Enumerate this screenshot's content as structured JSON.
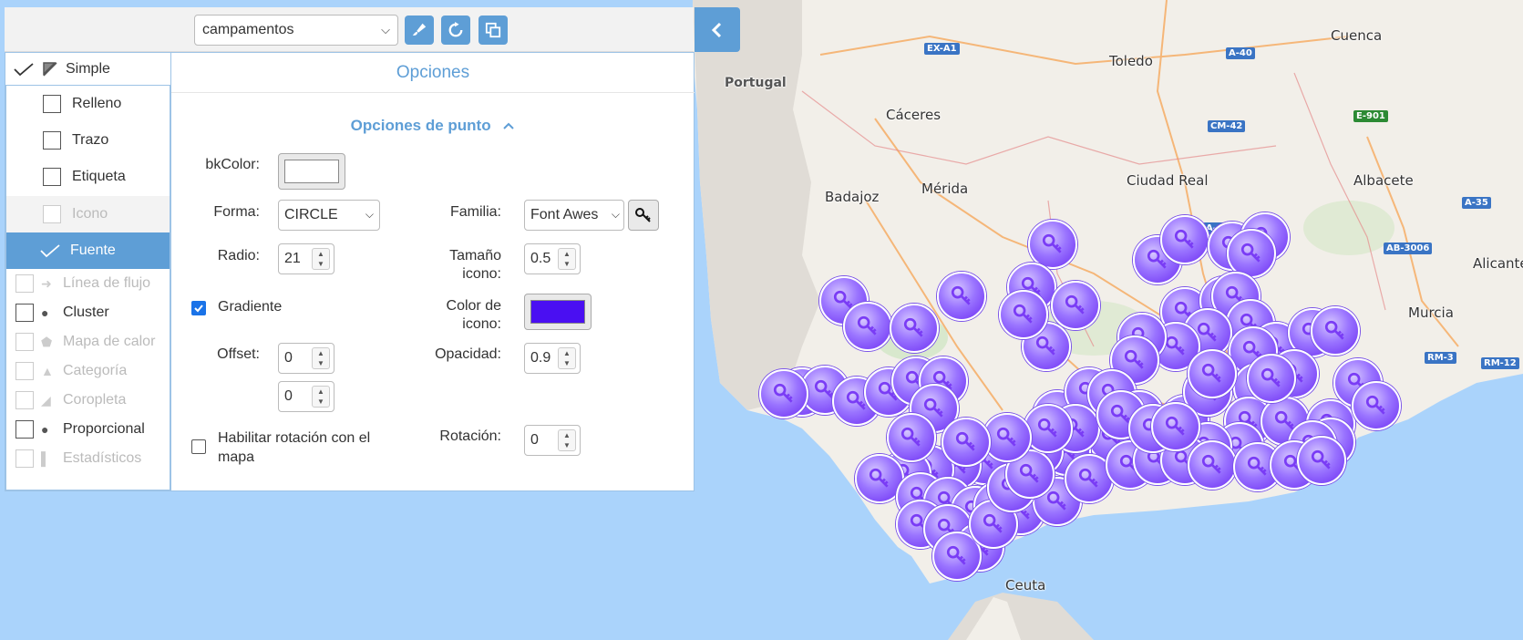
{
  "toolbar": {
    "layer_select_value": "campamentos",
    "buttons": [
      "brush-icon",
      "refresh-icon",
      "copy-icon"
    ],
    "collapse_icon": "chevron-left-icon"
  },
  "style_types": {
    "simple": {
      "label": "Simple",
      "checked": true
    },
    "sub_items": [
      {
        "label": "Relleno",
        "checked": false,
        "disabled": false
      },
      {
        "label": "Trazo",
        "checked": false,
        "disabled": false
      },
      {
        "label": "Etiqueta",
        "checked": false,
        "disabled": false
      },
      {
        "label": "Icono",
        "checked": false,
        "disabled": true
      },
      {
        "label": "Fuente",
        "checked": true,
        "selected": true
      }
    ],
    "other_items": [
      {
        "label": "Línea de flujo",
        "icon": "arrow-right-icon",
        "disabled": true
      },
      {
        "label": "Cluster",
        "icon": "cluster-icon",
        "disabled": false
      },
      {
        "label": "Mapa de calor",
        "icon": "heatmap-icon",
        "disabled": true
      },
      {
        "label": "Categoría",
        "icon": "category-icon",
        "disabled": true
      },
      {
        "label": "Coropleta",
        "icon": "choropleth-icon",
        "disabled": true
      },
      {
        "label": "Proporcional",
        "icon": "proportional-icon",
        "disabled": false
      },
      {
        "label": "Estadísticos",
        "icon": "bar-chart-icon",
        "disabled": true
      }
    ]
  },
  "options": {
    "title": "Opciones",
    "point_section": "Opciones de punto",
    "bkcolor_label": "bkColor:",
    "bkcolor_value": "#ffffff",
    "forma_label": "Forma:",
    "forma_value": "CIRCLE",
    "familia_label": "Familia:",
    "familia_value": "Font Awes",
    "radio_label": "Radio:",
    "radio_value": "21",
    "tamano_label_1": "Tamaño",
    "tamano_label_2": "icono:",
    "tamano_value": "0.5",
    "gradiente_label": "Gradiente",
    "gradiente_checked": true,
    "color_icono_label_1": "Color de",
    "color_icono_label_2": "icono:",
    "color_icono_value": "#4a0ff2",
    "offset_label": "Offset:",
    "offset_x": "0",
    "offset_y": "0",
    "opacidad_label": "Opacidad:",
    "opacidad_value": "0.9",
    "rotacion_mapa_label_1": "Habilitar rotación con el",
    "rotacion_mapa_label_2": "mapa",
    "rotacion_label": "Rotación:",
    "rotacion_value": "0"
  },
  "map": {
    "labels": [
      "Portugal",
      "Toledo",
      "Cuenca",
      "Cáceres",
      "Ciudad Real",
      "Mérida",
      "Badajoz",
      "Albacete",
      "Murcia",
      "Alicante",
      "Ceuta"
    ],
    "roads": [
      "EX-A1",
      "A-40",
      "CM-42",
      "E-901",
      "A-4A",
      "A-35",
      "AB-3006",
      "RM-3",
      "RM-12"
    ],
    "marker_color": "#7a3cf5"
  }
}
